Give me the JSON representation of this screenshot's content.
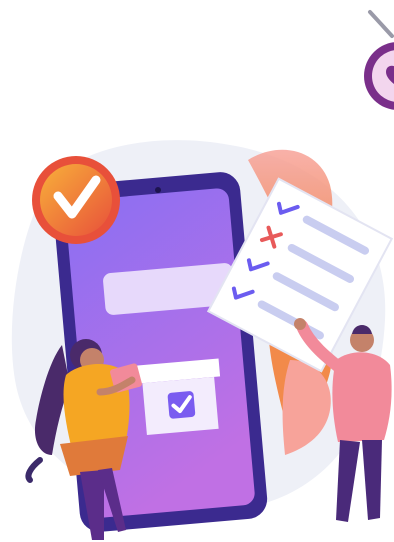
{
  "illustration": {
    "colors": {
      "background_blob": "#eef0f7",
      "phone_frame": "#3b2a8f",
      "phone_screen_top": "#8b6ff2",
      "phone_screen_bottom": "#b46ee8",
      "badge_orange": "#f8a13a",
      "badge_red": "#e8503a",
      "leaf_pink": "#f7a39a",
      "leaf_orange": "#f28a4a",
      "checklist_paper": "#ffffff",
      "checklist_line": "#c9cdf0",
      "check_blue": "#6b5cf0",
      "cross_red": "#e85a5a",
      "woman_shirt": "#f5a623",
      "woman_pants": "#5b2d8a",
      "man_shirt": "#f28a9a",
      "man_pants": "#4a2a7a",
      "corner_badge": "#7a2f8a"
    },
    "icons": {
      "top_badge": "checkmark-badge-icon",
      "corner_badge": "heart-badge-icon",
      "screen_box": "checkbox-icon"
    },
    "checklist": {
      "items": [
        {
          "mark": "check"
        },
        {
          "mark": "cross"
        },
        {
          "mark": "check"
        },
        {
          "mark": "check"
        }
      ]
    }
  }
}
